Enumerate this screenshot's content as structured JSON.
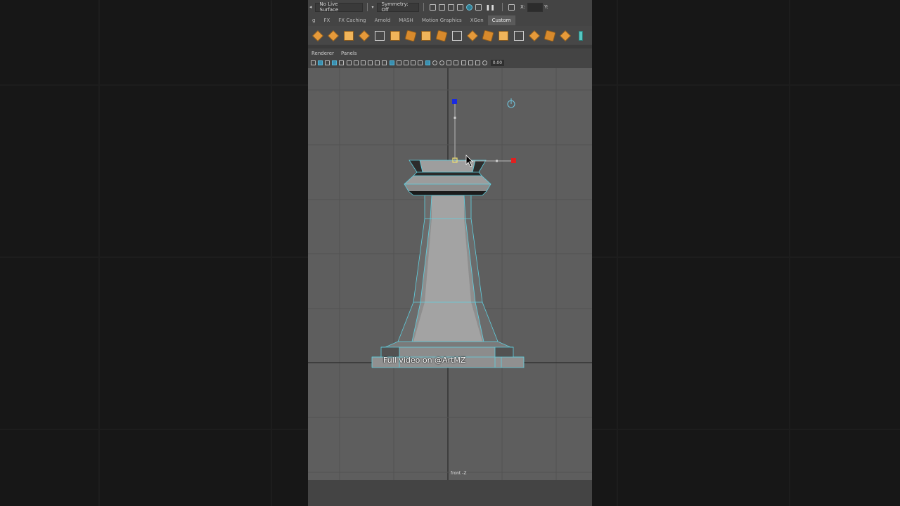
{
  "status_line": {
    "live_surface": "No Live Surface",
    "symmetry": "Symmetry: Off",
    "x_label": "X:",
    "y_label": "Y:"
  },
  "shelf_tabs": [
    "g",
    "FX",
    "FX Caching",
    "Arnold",
    "MASH",
    "Motion Graphics",
    "XGen",
    "Custom"
  ],
  "active_tab": "Custom",
  "panel_menu": [
    "Renderer",
    "Panels"
  ],
  "panel_toolbar": {
    "exposure_value": "0.00"
  },
  "viewport": {
    "camera_label": "front -Z",
    "overlay_text": "Full video on @ArtMZ",
    "wireframe_color": "#5fd0e0",
    "manipulator_colors": {
      "x_axis": "#e02020",
      "y_axis": "#1a2ae0",
      "center": "#f0e070"
    }
  },
  "colors": {
    "background": "#151515",
    "ui_panel": "#444444",
    "viewport_bg": "#5e5e5e",
    "active_tab": "#5a5a5a"
  }
}
